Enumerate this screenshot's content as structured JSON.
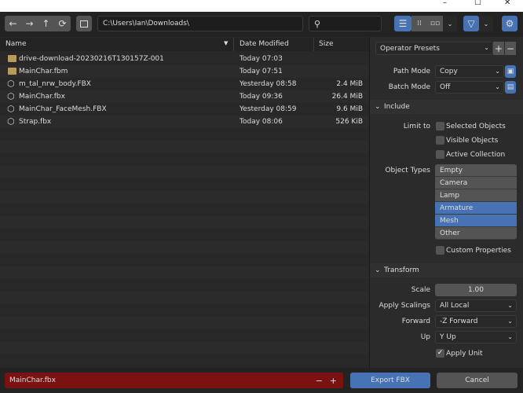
{
  "window": {
    "minimize": "–",
    "maximize": "☐",
    "close": "✕"
  },
  "toolbar": {
    "back": "←",
    "forward": "→",
    "parent": "↑",
    "refresh": "⟳",
    "path": "C:\\Users\\Ian\\Downloads\\",
    "search_placeholder": ""
  },
  "columns": {
    "name": "Name",
    "date": "Date Modified",
    "size": "Size"
  },
  "files": [
    {
      "name": "drive-download-20230216T130157Z-001",
      "date": "Today 07:03",
      "size": "",
      "type": "folder"
    },
    {
      "name": "MainChar.fbm",
      "date": "Today 07:51",
      "size": "",
      "type": "folder"
    },
    {
      "name": "m_tal_nrw_body.FBX",
      "date": "Yesterday 08:58",
      "size": "2.4 MiB",
      "type": "mesh"
    },
    {
      "name": "MainChar.fbx",
      "date": "Today 09:36",
      "size": "26.4 MiB",
      "type": "mesh"
    },
    {
      "name": "MainChar_FaceMesh.FBX",
      "date": "Yesterday 08:59",
      "size": "9.6 MiB",
      "type": "mesh"
    },
    {
      "name": "Strap.fbx",
      "date": "Today 08:06",
      "size": "526 KiB",
      "type": "mesh"
    }
  ],
  "side": {
    "presets": "Operator Presets",
    "path_mode_label": "Path Mode",
    "path_mode": "Copy",
    "batch_mode_label": "Batch Mode",
    "batch_mode": "Off",
    "include": "Include",
    "limit_to": "Limit to",
    "limit": [
      "Selected Objects",
      "Visible Objects",
      "Active Collection"
    ],
    "object_types_label": "Object Types",
    "object_types": [
      {
        "label": "Empty",
        "selected": false
      },
      {
        "label": "Camera",
        "selected": false
      },
      {
        "label": "Lamp",
        "selected": false
      },
      {
        "label": "Armature",
        "selected": true
      },
      {
        "label": "Mesh",
        "selected": true
      },
      {
        "label": "Other",
        "selected": false
      }
    ],
    "custom_props": "Custom Properties",
    "transform": "Transform",
    "scale_label": "Scale",
    "scale": "1.00",
    "apply_scalings_label": "Apply Scalings",
    "apply_scalings": "All Local",
    "forward_label": "Forward",
    "forward": "-Z Forward",
    "up_label": "Up",
    "up": "Y Up",
    "apply_unit": "Apply Unit"
  },
  "bottom": {
    "filename": "MainChar.fbx",
    "minus": "−",
    "plus": "+",
    "export": "Export FBX",
    "cancel": "Cancel"
  },
  "colors": {
    "accent": "#4772b3",
    "filename_error": "#7a1212"
  }
}
